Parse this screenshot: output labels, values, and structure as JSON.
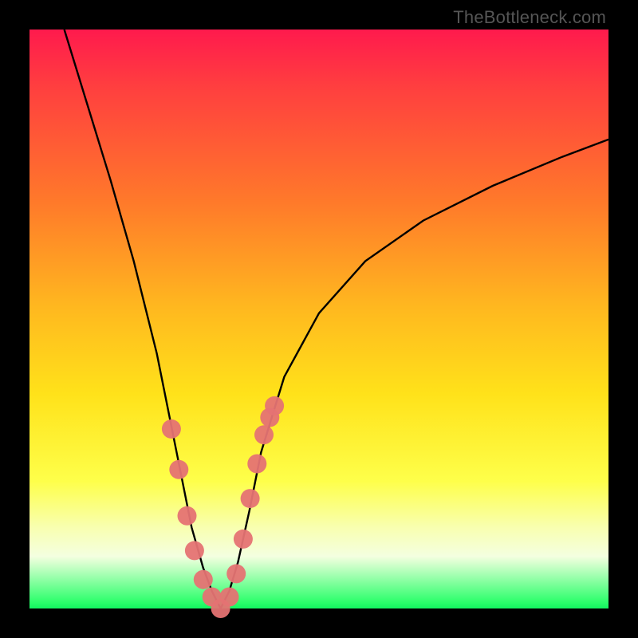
{
  "watermark": "TheBottleneck.com",
  "chart_data": {
    "type": "line",
    "title": "",
    "xlabel": "",
    "ylabel": "",
    "xlim": [
      0,
      100
    ],
    "ylim": [
      0,
      100
    ],
    "series": [
      {
        "name": "bottleneck-curve",
        "x": [
          6,
          10,
          14,
          18,
          22,
          26,
          28,
          30,
          31.5,
          33,
          34.5,
          36,
          38,
          40,
          44,
          50,
          58,
          68,
          80,
          92,
          100
        ],
        "y": [
          100,
          87,
          74,
          60,
          44,
          24,
          14,
          7,
          3,
          0,
          3,
          8,
          17,
          27,
          40,
          51,
          60,
          67,
          73,
          78,
          81
        ]
      }
    ],
    "markers": {
      "name": "highlight-dots",
      "x": [
        24.5,
        25.8,
        27.2,
        28.5,
        30,
        31.5,
        33,
        34.5,
        35.7,
        36.9,
        38.1,
        39.3,
        40.5,
        41.5,
        42.3
      ],
      "y": [
        31,
        24,
        16,
        10,
        5,
        2,
        0,
        2,
        6,
        12,
        19,
        25,
        30,
        33,
        35
      ],
      "r": 12
    },
    "background_gradient": {
      "stops": [
        {
          "pos": 0.0,
          "color": "#ff1a4d"
        },
        {
          "pos": 0.1,
          "color": "#ff3f3f"
        },
        {
          "pos": 0.3,
          "color": "#ff7a2a"
        },
        {
          "pos": 0.48,
          "color": "#ffb81f"
        },
        {
          "pos": 0.63,
          "color": "#ffe21a"
        },
        {
          "pos": 0.78,
          "color": "#feff4a"
        },
        {
          "pos": 0.86,
          "color": "#f8ffb0"
        },
        {
          "pos": 0.91,
          "color": "#f4ffe0"
        },
        {
          "pos": 0.99,
          "color": "#2aff6a"
        },
        {
          "pos": 1.0,
          "color": "#12f560"
        }
      ]
    }
  }
}
